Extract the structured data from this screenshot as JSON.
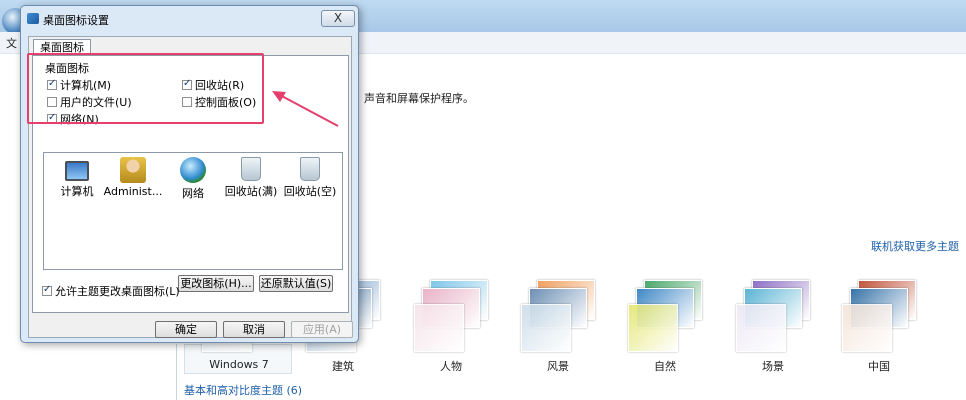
{
  "background_window": {
    "menu_text": "文",
    "description": "声音和屏幕保护程序。",
    "online_themes_link": "联机获取更多主题",
    "section_basic": "基本和高对比度主题 (6)",
    "themes": [
      {
        "label": "Windows 7",
        "colors": [
          "#dfe9f3",
          "#f3f6fa",
          "#eaf0f6"
        ]
      },
      {
        "label": "建筑",
        "colors": [
          "#6e9ac6",
          "#3d6fa3",
          "#aac7e2"
        ]
      },
      {
        "label": "人物",
        "colors": [
          "#7ec6e9",
          "#e8b3c7",
          "#f5e2e9"
        ]
      },
      {
        "label": "风景",
        "colors": [
          "#f0a060",
          "#6c8fb4",
          "#c9dbe8"
        ]
      },
      {
        "label": "自然",
        "colors": [
          "#4aa86a",
          "#3f88c5",
          "#e3e66a"
        ]
      },
      {
        "label": "场景",
        "colors": [
          "#8e6fc4",
          "#5bb3d4",
          "#ece7f4"
        ]
      },
      {
        "label": "中国",
        "colors": [
          "#c0533a",
          "#3672a8",
          "#f3e2d5"
        ]
      }
    ]
  },
  "dialog": {
    "title": "桌面图标设置",
    "close_symbol": "X",
    "tab_label": "桌面图标",
    "group_title": "桌面图标",
    "checkboxes": [
      {
        "label": "计算机(M)",
        "checked": true
      },
      {
        "label": "回收站(R)",
        "checked": true
      },
      {
        "label": "用户的文件(U)",
        "checked": false
      },
      {
        "label": "控制面板(O)",
        "checked": false
      },
      {
        "label": "网络(N)",
        "checked": true
      }
    ],
    "icons": [
      {
        "label": "计算机",
        "icon": "computer-icon"
      },
      {
        "label": "Administ...",
        "icon": "user-folder-icon"
      },
      {
        "label": "网络",
        "icon": "network-icon"
      },
      {
        "label": "回收站(满)",
        "icon": "recycle-bin-full-icon"
      },
      {
        "label": "回收站(空)",
        "icon": "recycle-bin-empty-icon"
      }
    ],
    "change_icon_button": "更改图标(H)...",
    "restore_default_button": "还原默认值(S)",
    "allow_themes_checkbox": {
      "label": "允许主题更改桌面图标(L)",
      "checked": true
    },
    "ok_button": "确定",
    "cancel_button": "取消",
    "apply_button": "应用(A)"
  },
  "annotation": {
    "color": "#e53f6d"
  }
}
